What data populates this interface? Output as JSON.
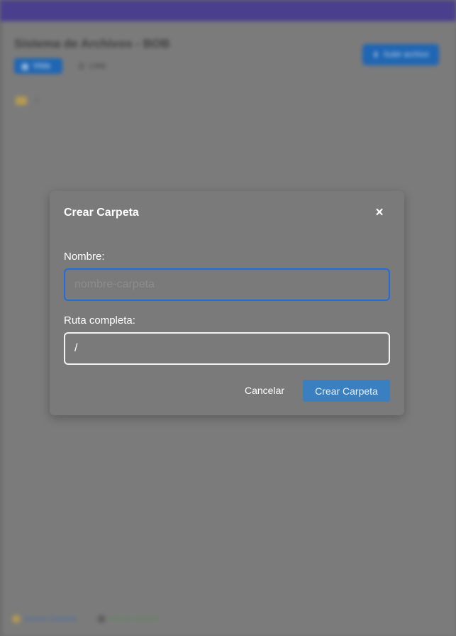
{
  "app": {
    "title": "Sistema de Archivos - BOB",
    "view_grid_label": "Vista",
    "view_list_label": "Lista",
    "upload_label": "Subir archivo",
    "breadcrumb_root": "/",
    "footer_link_1": "Nueva Carpeta",
    "footer_link_2": "Nuevo Archivo"
  },
  "modal": {
    "title": "Crear Carpeta",
    "close_symbol": "×",
    "name_label": "Nombre:",
    "name_placeholder": "nombre-carpeta",
    "name_value": "",
    "path_label": "Ruta completa:",
    "path_value": "/",
    "cancel_label": "Cancelar",
    "submit_label": "Crear Carpeta"
  },
  "colors": {
    "accent": "#1e6ee0",
    "primary_button": "#3a80c0",
    "overlay": "#6f6f6f",
    "header": "#4a3f8c"
  },
  "icons": {
    "close": "close-icon",
    "folder": "folder-icon",
    "upload": "upload-icon"
  }
}
